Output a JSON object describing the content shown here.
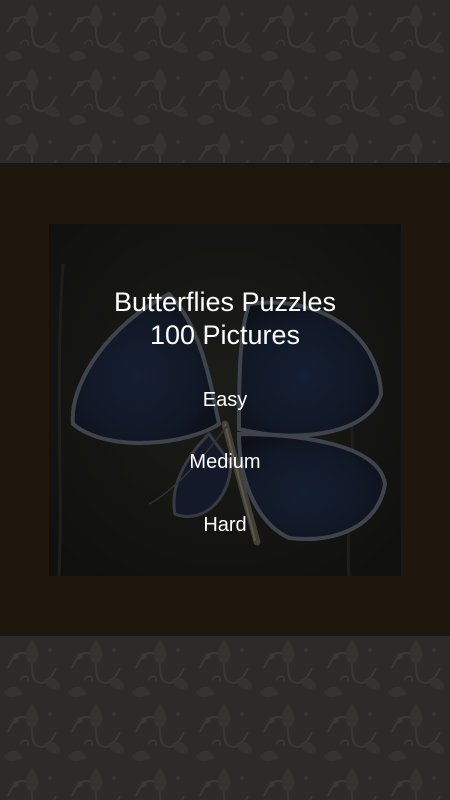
{
  "title": {
    "line1": "Butterflies Puzzles",
    "line2": "100 Pictures"
  },
  "menu": {
    "easy": "Easy",
    "medium": "Medium",
    "hard": "Hard"
  },
  "colors": {
    "background_pattern": "#2c2b29",
    "frame": "#1f160e",
    "text": "#ffffff",
    "butterfly_wing": "#1c2a47"
  },
  "background_image": "butterfly-photo"
}
